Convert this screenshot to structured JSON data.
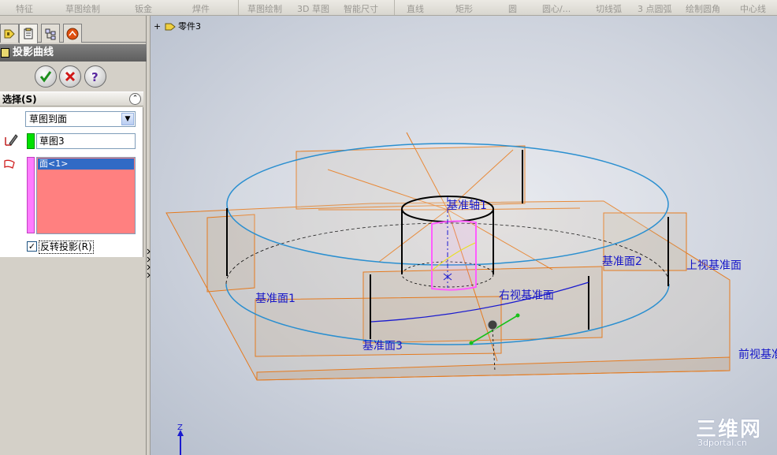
{
  "toolbar": {
    "items": [
      "特征",
      "草图绘制",
      "钣金",
      "焊件",
      "草图绘制",
      "3D 草图",
      "智能尺寸",
      "直线",
      "矩形",
      "圆",
      "圆心/...",
      "切线弧",
      "3 点圆弧",
      "绘制圆角",
      "中心线"
    ]
  },
  "property_manager": {
    "title": "投影曲线",
    "section_title": "选择(S)",
    "projection_type": "草图到面",
    "sketch_field": "草图3",
    "face_list": [
      "面<1>"
    ],
    "reverse_checkbox_label": "反转投影(R)",
    "reverse_checked": true
  },
  "viewport": {
    "tree_root": "零件3",
    "labels": {
      "axis1": "基准轴1",
      "plane2": "基准面2",
      "top_plane": "上视基准面",
      "plane1": "基准面1",
      "right_plane": "右视基准面",
      "plane3": "基准面3",
      "front_plane": "前视基准"
    },
    "triad_z": "Z",
    "watermark": "三维网",
    "watermark_url": "3dportal.cn"
  },
  "colors": {
    "plane_edge": "#e57a1e",
    "model_edge": "#2a8fd0",
    "label": "#1515c8",
    "curve": "#1a1acf",
    "sketch_selected": "#ff5cff"
  }
}
